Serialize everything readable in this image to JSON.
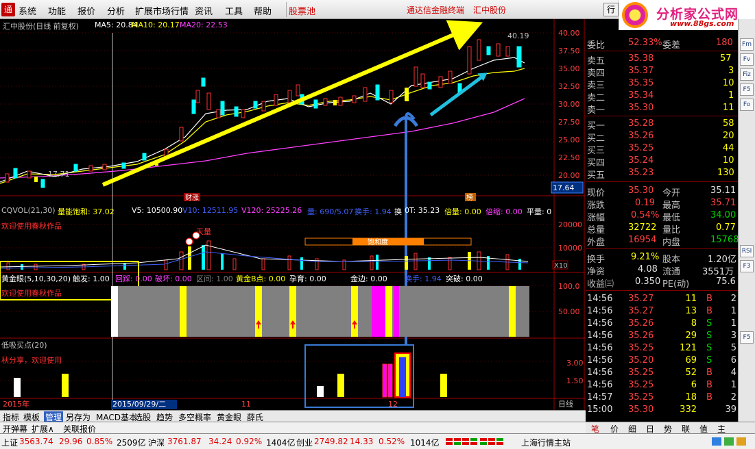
{
  "menu": {
    "items": [
      "系统",
      "功能",
      "报价",
      "分析",
      "扩展市场行情",
      "资讯",
      "工具",
      "帮助"
    ],
    "special": "股票池",
    "promo1": "通达信金融终端",
    "promo2": "汇中股份",
    "trade": "行"
  },
  "logo": {
    "title": "分析家公式网",
    "url": "www.88gs.com"
  },
  "main_chart": {
    "title": "汇中股份(日线 前复权)",
    "ma5": "MA5: 20.84",
    "ma10": "MA10: 20.17",
    "ma20": "MA20: 22.53",
    "high_label": "40.19",
    "low_label": "17.71",
    "current_price_tag": "17.64",
    "tag_left": "财涨",
    "tag_right": "榜",
    "yaxis": [
      "40.00",
      "37.50",
      "35.00",
      "32.50",
      "30.00",
      "27.50",
      "25.00",
      "22.50",
      "20.00"
    ]
  },
  "chart_data": [
    {
      "type": "line",
      "title": "汇中股份(日线 前复权)",
      "note": "candlestick price chart with MA5/MA10/MA20",
      "ylim": [
        17.5,
        40.5
      ],
      "yticks": [
        20,
        22.5,
        25,
        27.5,
        30,
        32.5,
        35,
        37.5,
        40
      ],
      "high": 40.19,
      "low": 17.71,
      "series": [
        {
          "name": "MA5",
          "values": [
            20.84
          ]
        },
        {
          "name": "MA10",
          "values": [
            20.17
          ]
        },
        {
          "name": "MA20",
          "values": [
            22.53
          ]
        }
      ]
    },
    {
      "type": "bar",
      "title": "CQVOL(21,30)",
      "yticks": [
        10000,
        20000
      ]
    },
    {
      "type": "bar",
      "title": "黄金眼(5,10,30,20)",
      "yticks": [
        50,
        100
      ]
    },
    {
      "type": "bar",
      "title": "低吸买点(20)",
      "yticks": [
        1.5,
        3.0
      ]
    }
  ],
  "vol_panel": {
    "title": "CQVOL(21,30)",
    "labels": [
      "量能饱和: 37.02",
      "V5: 10500.90",
      "V10: 12511.95",
      "V120: 25225.26",
      "量: 690/5.07",
      "换手: 1.94",
      "换",
      "0T: 35.23",
      "倍量: 0.00",
      "倍缩: 0.00",
      "平量: 0"
    ],
    "welcome": "欢迎使用春秋作品",
    "saturation": "饱和度",
    "annot": "天量",
    "yaxis": [
      "20000",
      "10000"
    ],
    "x10": "X10"
  },
  "eye_panel": {
    "title": "黄金眼(5,10,30,20)",
    "labels": [
      "触发: 1.00",
      "回踩: 0.00",
      "破坏: 0.00",
      "区间: 1.00",
      "黄金B点: 0.00",
      "孕育: 0.00",
      "金边: 0.00",
      "换手: 1.94",
      "突破: 0.00"
    ],
    "welcome": "欢迎使用春秋作品",
    "yaxis": [
      "100.0",
      "50.00"
    ]
  },
  "low_panel": {
    "title": "低吸买点(20)",
    "share": "秋分享，欢迎使用",
    "yaxis": [
      "3.00",
      "1.50"
    ]
  },
  "date_axis": {
    "year": "2015年",
    "cursor": "2015/09/29/二",
    "m11": "11",
    "m12": "12",
    "period": "日线"
  },
  "quote": {
    "weibi_lbl": "委比",
    "weibi": "52.33%",
    "weicha_lbl": "委差",
    "weicha": "180",
    "sells": [
      {
        "l": "卖五",
        "p": "35.38",
        "v": "57"
      },
      {
        "l": "卖四",
        "p": "35.37",
        "v": "3"
      },
      {
        "l": "卖三",
        "p": "35.35",
        "v": "10"
      },
      {
        "l": "卖二",
        "p": "35.34",
        "v": "1"
      },
      {
        "l": "卖一",
        "p": "35.30",
        "v": "11"
      }
    ],
    "buys": [
      {
        "l": "买一",
        "p": "35.28",
        "v": "58"
      },
      {
        "l": "买二",
        "p": "35.26",
        "v": "20"
      },
      {
        "l": "买三",
        "p": "35.25",
        "v": "44"
      },
      {
        "l": "买四",
        "p": "35.24",
        "v": "10"
      },
      {
        "l": "买五",
        "p": "35.23",
        "v": "130"
      }
    ],
    "stats": [
      {
        "l1": "现价",
        "v1": "35.30",
        "l2": "今开",
        "v2": "35.11"
      },
      {
        "l1": "涨跌",
        "v1": "0.19",
        "l2": "最高",
        "v2": "35.71"
      },
      {
        "l1": "涨幅",
        "v1": "0.54%",
        "l2": "最低",
        "v2": "34.00"
      },
      {
        "l1": "总量",
        "v1": "32722",
        "l2": "量比",
        "v2": "0.77"
      },
      {
        "l1": "外盘",
        "v1": "16954",
        "l2": "内盘",
        "v2": "15768"
      }
    ],
    "stats2": [
      {
        "l1": "换手",
        "v1": "9.21%",
        "l2": "股本",
        "v2": "1.20亿"
      },
      {
        "l1": "净资",
        "v1": "4.08",
        "l2": "流通",
        "v2": "3551万"
      },
      {
        "l1": "收益㈢",
        "v1": "0.350",
        "l2": "PE(动)",
        "v2": "75.6"
      }
    ],
    "ticks": [
      {
        "t": "14:56",
        "p": "35.27",
        "v": "11",
        "s": "B",
        "n": "2"
      },
      {
        "t": "14:56",
        "p": "35.27",
        "v": "13",
        "s": "B",
        "n": "1"
      },
      {
        "t": "14:56",
        "p": "35.26",
        "v": "8",
        "s": "S",
        "n": "1"
      },
      {
        "t": "14:56",
        "p": "35.26",
        "v": "29",
        "s": "S",
        "n": "3"
      },
      {
        "t": "14:56",
        "p": "35.25",
        "v": "121",
        "s": "S",
        "n": "5"
      },
      {
        "t": "14:56",
        "p": "35.20",
        "v": "69",
        "s": "S",
        "n": "6"
      },
      {
        "t": "14:56",
        "p": "35.25",
        "v": "52",
        "s": "B",
        "n": "4"
      },
      {
        "t": "14:56",
        "p": "35.25",
        "v": "6",
        "s": "B",
        "n": "1"
      },
      {
        "t": "14:57",
        "p": "35.25",
        "v": "18",
        "s": "B",
        "n": "2"
      },
      {
        "t": "15:00",
        "p": "35.30",
        "v": "332",
        "s": "",
        "n": "39"
      }
    ]
  },
  "tabs1": [
    "指标",
    "模板",
    "管理",
    "另存为",
    "MACD基本",
    "选股",
    "趋势",
    "多空概率",
    "黄金眼",
    "薛氏"
  ],
  "tabs2": [
    "开弹幕",
    "扩展∧",
    "关联报价"
  ],
  "ttabs": [
    "笔",
    "价",
    "细",
    "日",
    "势",
    "联",
    "值",
    "主"
  ],
  "status": {
    "sh_lbl": "上证",
    "sh": "3563.74",
    "sh_chg": "29.96",
    "sh_pct": "0.85%",
    "sh_amt": "2509亿",
    "sz_lbl": "沪深",
    "sz": "3761.87",
    "sz_chg": "34.24",
    "sz_pct": "0.92%",
    "sz_amt": "1404亿",
    "cy_lbl": "创业",
    "cy": "2749.82",
    "cy_chg": "14.33",
    "cy_pct": "0.52%",
    "cy_amt": "1014亿",
    "server": "上海行情主站"
  },
  "rtb": [
    "Fm",
    "Fv",
    "Fiz",
    "F5",
    "Fo",
    "RSI",
    "F3",
    "F5"
  ]
}
